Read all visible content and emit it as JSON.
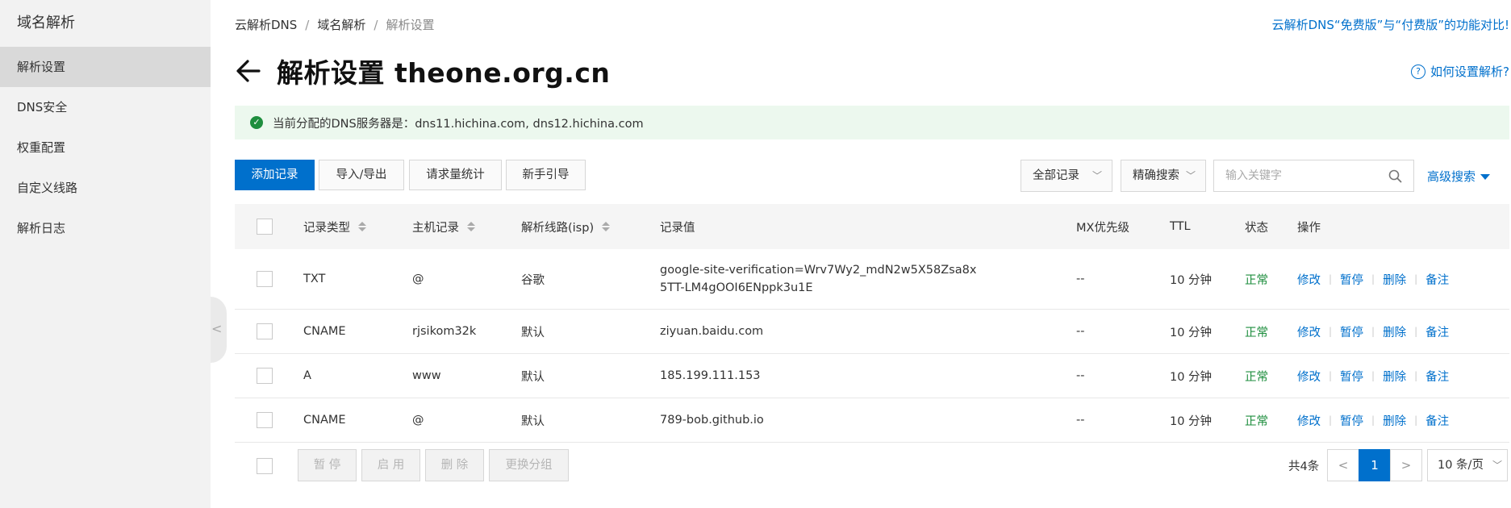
{
  "sidebar": {
    "title": "域名解析",
    "items": [
      {
        "label": "解析设置",
        "active": true
      },
      {
        "label": "DNS安全"
      },
      {
        "label": "权重配置"
      },
      {
        "label": "自定义线路"
      },
      {
        "label": "解析日志"
      }
    ],
    "collapse_glyph": "<"
  },
  "breadcrumb": [
    "云解析DNS",
    "域名解析",
    "解析设置"
  ],
  "breadcrumb_sep": "/",
  "compare_link": "云解析DNS“免费版”与“付费版”的功能对比!",
  "page_title": "解析设置 theone.org.cn",
  "help_link": "如何设置解析?",
  "notice": "当前分配的DNS服务器是：dns11.hichina.com, dns12.hichina.com",
  "toolbar": {
    "add": "添加记录",
    "import_export": "导入/导出",
    "stats": "请求量统计",
    "guide": "新手引导",
    "filter_all": "全部记录",
    "precise_search": "精确搜索",
    "search_placeholder": "输入关键字",
    "advanced": "高级搜索"
  },
  "table": {
    "headers": {
      "type": "记录类型",
      "host": "主机记录",
      "line": "解析线路(isp)",
      "value": "记录值",
      "mx": "MX优先级",
      "ttl": "TTL",
      "status": "状态",
      "ops": "操作"
    },
    "rows": [
      {
        "type": "TXT",
        "host": "@",
        "line": "谷歌",
        "value": "google-site-verification=Wrv7Wy2_mdN2w5X58Zsa8x5TT-LM4gOOI6ENppk3u1E",
        "mx": "--",
        "ttl": "10 分钟",
        "status": "正常"
      },
      {
        "type": "CNAME",
        "host": "rjsikom32k",
        "line": "默认",
        "value": "ziyuan.baidu.com",
        "mx": "--",
        "ttl": "10 分钟",
        "status": "正常"
      },
      {
        "type": "A",
        "host": "www",
        "line": "默认",
        "value": "185.199.111.153",
        "mx": "--",
        "ttl": "10 分钟",
        "status": "正常"
      },
      {
        "type": "CNAME",
        "host": "@",
        "line": "默认",
        "value": "789-bob.github.io",
        "mx": "--",
        "ttl": "10 分钟",
        "status": "正常"
      }
    ],
    "ops": {
      "edit": "修改",
      "pause": "暂停",
      "delete": "删除",
      "note": "备注"
    }
  },
  "footer": {
    "pause": "暂 停",
    "enable": "启 用",
    "delete": "删 除",
    "change_group": "更换分组",
    "total": "共4条",
    "prev": "<",
    "page": "1",
    "next": ">",
    "page_size": "10 条/页"
  },
  "colors": {
    "primary": "#0070cc",
    "success": "#1e8e3e",
    "notice_bg": "#ecf8ee"
  }
}
